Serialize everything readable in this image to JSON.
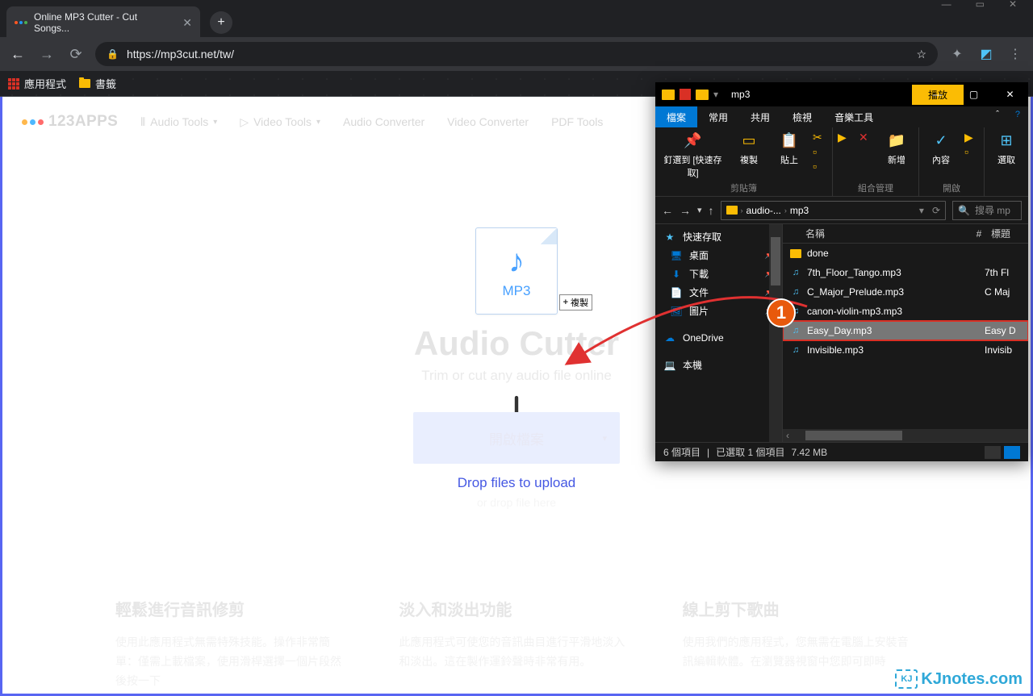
{
  "browser": {
    "tab_title": "Online MP3 Cutter - Cut Songs...",
    "url": "https://mp3cut.net/tw/",
    "bookmarks_bar": {
      "apps": "應用程式",
      "bookmarks": "書籤"
    }
  },
  "site": {
    "logo": "123APPS",
    "nav": {
      "audio_tools": "Audio Tools",
      "video_tools": "Video Tools",
      "audio_converter": "Audio Converter",
      "video_converter": "Video Converter",
      "pdf_tools": "PDF Tools"
    },
    "mp3_badge": "MP3",
    "copy_tag": "複製",
    "title": "Audio Cutter",
    "subtitle": "Trim or cut any audio file online",
    "open_btn": "開啟檔案",
    "drop_text": "Drop files to upload",
    "drop_hint": "or drop file here",
    "features": {
      "f1_title": "輕鬆進行音訊修剪",
      "f1_body": "使用此應用程式無需特殊技能。操作非常簡單：僅需上載檔案，使用滑桿選擇一個片段然後按一下",
      "f2_title": "淡入和淡出功能",
      "f2_body": "此應用程式可使您的音訊曲目進行平滑地淡入和淡出。這在製作運鈴聲時非常有用。",
      "f3_title": "線上剪下歌曲",
      "f3_body": "使用我們的應用程式，您無需在電腦上安裝音訊編輯軟體。在瀏覽器視窗中您即可即時"
    }
  },
  "annotation": {
    "badge": "1"
  },
  "explorer": {
    "title": "mp3",
    "play_tab": "播放",
    "tabs": {
      "file": "檔案",
      "home": "常用",
      "share": "共用",
      "view": "檢視",
      "music": "音樂工具"
    },
    "ribbon": {
      "pin": "釘選到 [快速存取]",
      "copy": "複製",
      "paste": "貼上",
      "clipboard_group": "剪貼簿",
      "new": "新增",
      "organize_group": "組合管理",
      "properties": "內容",
      "open_group": "開啟",
      "select": "選取"
    },
    "breadcrumb": {
      "parent": "audio-...",
      "current": "mp3"
    },
    "search_placeholder": "搜尋 mp",
    "sidebar": {
      "quick_access": "快速存取",
      "desktop": "桌面",
      "downloads": "下載",
      "documents": "文件",
      "pictures": "圖片",
      "onedrive": "OneDrive",
      "this_pc": "本機"
    },
    "columns": {
      "name": "名稱",
      "num": "#",
      "title": "標題"
    },
    "files": [
      {
        "name": "done",
        "type": "folder",
        "title": ""
      },
      {
        "name": "7th_Floor_Tango.mp3",
        "type": "audio",
        "title": "7th Fl"
      },
      {
        "name": "C_Major_Prelude.mp3",
        "type": "audio",
        "title": "C Maj"
      },
      {
        "name": "canon-violin-mp3.mp3",
        "type": "audio",
        "title": ""
      },
      {
        "name": "Easy_Day.mp3",
        "type": "audio",
        "title": "Easy D",
        "selected": true
      },
      {
        "name": "Invisible.mp3",
        "type": "audio",
        "title": "Invisib"
      }
    ],
    "status": {
      "items": "6 個項目",
      "selected": "已選取 1 個項目",
      "size": "7.42 MB"
    }
  },
  "watermark": "KJnotes.com"
}
